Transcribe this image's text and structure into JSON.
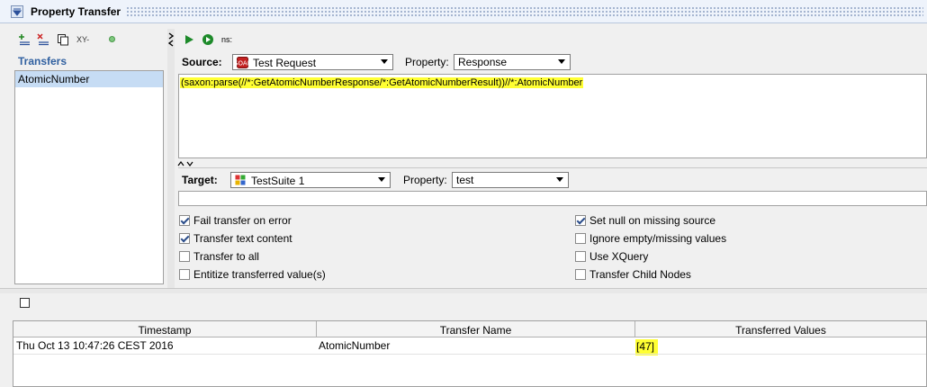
{
  "window": {
    "title": "Property Transfer"
  },
  "left_toolbar": {
    "rename_label": "XY-"
  },
  "transfers": {
    "header": "Transfers",
    "items": [
      {
        "label": "AtomicNumber",
        "selected": true
      }
    ]
  },
  "right_toolbar": {
    "ns_label": "ns:"
  },
  "source": {
    "label": "Source:",
    "step": "Test Request",
    "property_label": "Property:",
    "property": "Response",
    "expression": "(saxon:parse(//*:GetAtomicNumberResponse/*:GetAtomicNumberResult))//*:AtomicNumber"
  },
  "target": {
    "label": "Target:",
    "step": "TestSuite 1",
    "property_label": "Property:",
    "property": "test",
    "expression": ""
  },
  "options": {
    "left": [
      {
        "label": "Fail transfer on error",
        "checked": true
      },
      {
        "label": "Transfer text content",
        "checked": true
      },
      {
        "label": "Transfer to all",
        "checked": false
      },
      {
        "label": "Entitize transferred value(s)",
        "checked": false
      }
    ],
    "right": [
      {
        "label": "Set null on missing source",
        "checked": true
      },
      {
        "label": "Ignore empty/missing values",
        "checked": false
      },
      {
        "label": "Use XQuery",
        "checked": false
      },
      {
        "label": "Transfer Child Nodes",
        "checked": false
      }
    ]
  },
  "log": {
    "columns": [
      "Timestamp",
      "Transfer Name",
      "Transferred Values"
    ],
    "rows": [
      [
        "Thu Oct 13 10:47:26 CEST 2016",
        "AtomicNumber",
        "[47]"
      ]
    ]
  },
  "colors": {
    "highlight": "#ffff33",
    "selection": "#c6dcf4",
    "header_text": "#3060a0"
  }
}
